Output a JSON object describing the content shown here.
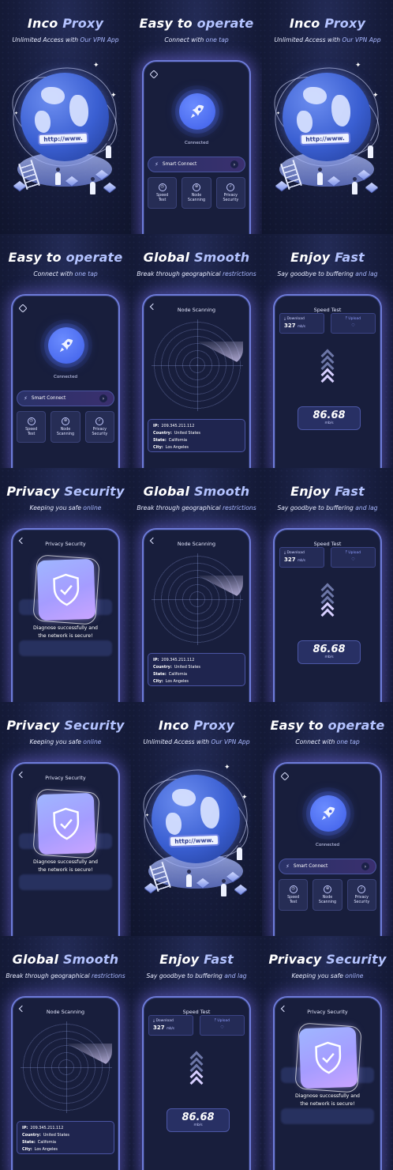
{
  "slides": {
    "inco": {
      "title_a": "Inco",
      "title_b": "Proxy",
      "sub_a": "Unlimited Access with ",
      "sub_b": "Our VPN App",
      "url": "http://www."
    },
    "easy": {
      "title_a": "Easy to ",
      "title_b": "operate",
      "sub_a": "Connect with ",
      "sub_b": "one tap",
      "connected": "Connected",
      "smart_connect": "Smart Connect",
      "feat1_a": "Speed",
      "feat1_b": "Test",
      "feat2_a": "Node",
      "feat2_b": "Scanning",
      "feat3_a": "Privacy",
      "feat3_b": "Security"
    },
    "global": {
      "title_a": "Global ",
      "title_b": "Smooth",
      "sub_a": "Break through geographical ",
      "sub_b": "restrictions",
      "screen_title": "Node Scanning",
      "ip_label": "IP:",
      "ip": "209.345.211.112",
      "country_label": "Country:",
      "country": "United States",
      "state_label": "State:",
      "state": "California",
      "city_label": "City:",
      "city": "Los Angeles"
    },
    "fast": {
      "title_a": "Enjoy ",
      "title_b": "Fast",
      "sub_a": "Say goodbye to buffering ",
      "sub_b": "and lag",
      "screen_title": "Speed Test",
      "download_label": "Download",
      "download_value": "327",
      "unit_small": "mb/s",
      "upload_label": "Upload",
      "speed": "86.68",
      "speed_unit": "mb/s"
    },
    "privacy": {
      "title_a": "Privacy ",
      "title_b": "Security",
      "sub_a": "Keeping you safe ",
      "sub_b": "online",
      "screen_title": "Privacy Security",
      "diag_a": "Diagnose successfully and",
      "diag_b": "the network is secure!"
    }
  },
  "layout_order": [
    "inco",
    "easy",
    "inco",
    "easy",
    "global",
    "fast",
    "privacy",
    "global",
    "fast",
    "privacy",
    "inco",
    "easy",
    "global",
    "fast",
    "privacy"
  ],
  "colors": {
    "accent": "#b4c3ff",
    "button": "#4f6ff0",
    "frame": "#6d7bd8"
  }
}
